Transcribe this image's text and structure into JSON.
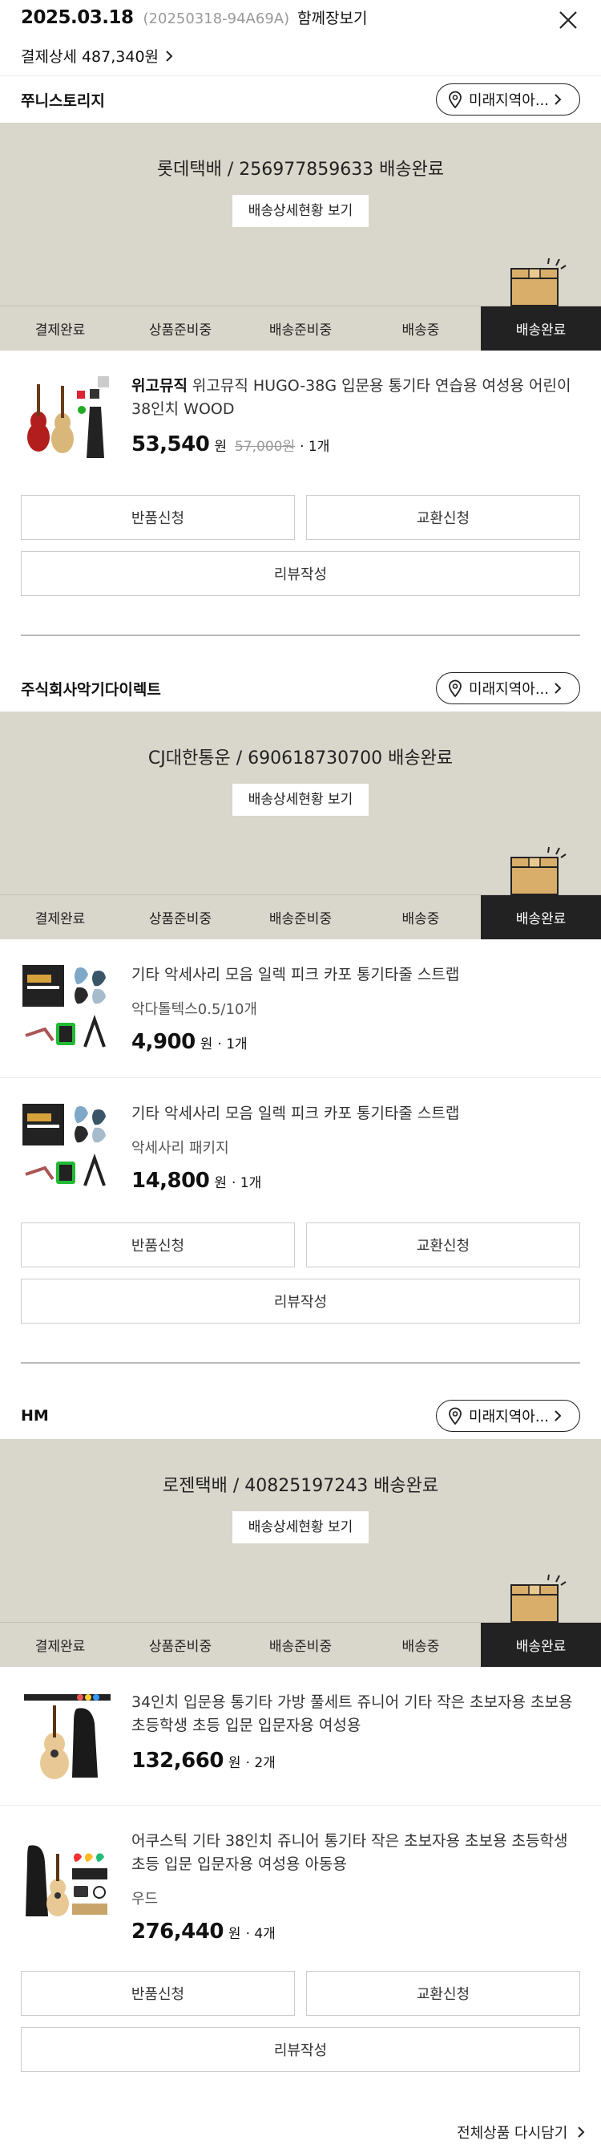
{
  "header": {
    "date": "2025.03.18",
    "order_no": "(20250318-94A69A)",
    "cart_label": "함께장보기",
    "payment_label": "결제상세 487,340원"
  },
  "steps": [
    "결제완료",
    "상품준비중",
    "배송준비중",
    "배송중",
    "배송완료"
  ],
  "location_label": "미래지역아...",
  "detail_button": "배송상세현황 보기",
  "buttons": {
    "return": "반품신청",
    "exchange": "교환신청",
    "review": "리뷰작성"
  },
  "sections": [
    {
      "seller": "쭈니스토리지",
      "tracking": "롯데택배 / 256977859633 배송완료",
      "items": [
        {
          "brand": "위고뮤직",
          "title": "위고뮤직 HUGO-38G 입문용 통기타 연습용 여성용 어린이 38인치 WOOD",
          "price": "53,540",
          "won": "원",
          "orig_price": "57,000원",
          "qty": "· 1개"
        }
      ]
    },
    {
      "seller": "주식회사악기다이렉트",
      "tracking": "CJ대한통운 / 690618730700 배송완료",
      "items": [
        {
          "title": "기타 악세사리 모음 일렉 피크 카포 통기타줄 스트랩",
          "option": "악다톨텍스0.5/10개",
          "price": "4,900",
          "won": "원",
          "qty": "· 1개"
        },
        {
          "title": "기타 악세사리 모음 일렉 피크 카포 통기타줄 스트랩",
          "option": "악세사리 패키지",
          "price": "14,800",
          "won": "원",
          "qty": "· 1개"
        }
      ]
    },
    {
      "seller": "HM",
      "tracking": "로젠택배 / 40825197243 배송완료",
      "items": [
        {
          "title": "34인치 입문용 통기타 가방 풀세트 쥬니어 기타 작은 초보자용 초보용 초등학생 초등 입문 입문자용 여성용",
          "price": "132,660",
          "won": "원",
          "qty": "· 2개"
        },
        {
          "title": "어쿠스틱 기타 38인치 쥬니어 통기타 작은 초보자용 초보용 초등학생 초등 입문 입문자용 여성용 아동용",
          "option": "우드",
          "price": "276,440",
          "won": "원",
          "qty": "· 4개"
        }
      ]
    }
  ],
  "footer": {
    "rebuy_label": "전체상품 다시담기"
  }
}
